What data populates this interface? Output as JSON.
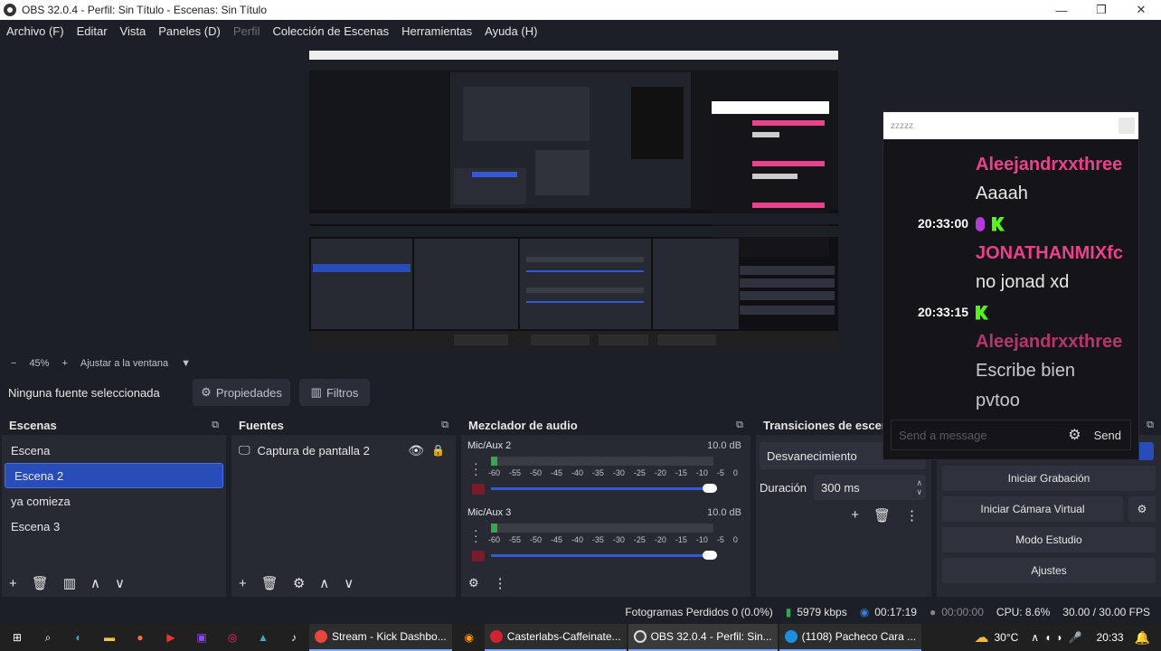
{
  "titlebar": {
    "title": "OBS 32.0.4 - Perfil: Sin Título - Escenas: Sin Título",
    "min": "—",
    "max": "❐",
    "close": "✕"
  },
  "menu": {
    "items": [
      {
        "label": "Archivo (F)"
      },
      {
        "label": "Editar"
      },
      {
        "label": "Vista"
      },
      {
        "label": "Paneles (D)"
      },
      {
        "label": "Perfil",
        "disabled": true
      },
      {
        "label": "Colección de Escenas"
      },
      {
        "label": "Herramientas"
      },
      {
        "label": "Ayuda (H)"
      }
    ]
  },
  "zoom": {
    "value": "45%",
    "minus": "−",
    "plus": "+",
    "fit_label": "Ajustar a la ventana"
  },
  "source_bar": {
    "none_selected": "Ninguna fuente seleccionada",
    "properties": "Propiedades",
    "filters": "Filtros"
  },
  "scenes": {
    "title": "Escenas",
    "items": [
      "Escena",
      "Escena 2",
      "ya comieza",
      "Escena 3"
    ],
    "selected_index": 1
  },
  "sources": {
    "title": "Fuentes",
    "items": [
      {
        "label": "Captura de pantalla 2"
      }
    ]
  },
  "mixer": {
    "title": "Mezclador de audio",
    "tracks": [
      {
        "name": "Mic/Aux 2",
        "db": "10.0 dB",
        "level": 0.03
      },
      {
        "name": "Mic/Aux 3",
        "db": "10.0 dB",
        "level": 0.03
      }
    ],
    "scale": [
      "-60",
      "-55",
      "-50",
      "-45",
      "-40",
      "-35",
      "-30",
      "-25",
      "-20",
      "-15",
      "-10",
      "-5",
      "0"
    ]
  },
  "transitions": {
    "title": "Transiciones de escen",
    "type": "Desvanecimiento",
    "duration_label": "Duración",
    "duration_value": "300 ms"
  },
  "controls": {
    "buttons": [
      "Iniciar Grabación",
      "Iniciar Cámara Virtual",
      "Modo Estudio",
      "Ajustes"
    ]
  },
  "status": {
    "dropped_frames": "Fotogramas Perdidos 0 (0.0%)",
    "bitrate": "5979 kbps",
    "stream_time": "00:17:19",
    "rec_time": "00:00:00",
    "cpu": "CPU: 8.6%",
    "fps": "30.00 / 30.00 FPS"
  },
  "chat": {
    "top_text": "zzzzz",
    "messages": [
      {
        "user": "Aleejandrxxthree",
        "text": "Aaaah",
        "time": "20:33:00",
        "mic_badge": true
      },
      {
        "user": "JONATHANMIXfc",
        "text": "no jonad xd",
        "time": "20:33:15",
        "mic_badge": false
      },
      {
        "user": "Aleejandrxxthree",
        "text": "Escribe bien pvtoo"
      }
    ],
    "placeholder": "Send a message",
    "send_label": "Send",
    "user_color": "#e8438a"
  },
  "taskbar": {
    "apps": [
      {
        "label": "Stream - Kick Dashbo...",
        "color": "#e8453c"
      },
      {
        "label": "Casterlabs-Caffeinate...",
        "color": "#d1242f"
      },
      {
        "label": "OBS 32.0.4 - Perfil: Sin...",
        "color": "#444"
      },
      {
        "label": "(1108) Pacheco Cara ...",
        "color": "#1d8fe0"
      }
    ],
    "temp": "30°C",
    "time": "20:33"
  },
  "colors": {
    "accent": "#284cb8",
    "kick_green": "#53fc18",
    "meter_green": "#33a852",
    "slider_blue": "#3559d6"
  }
}
